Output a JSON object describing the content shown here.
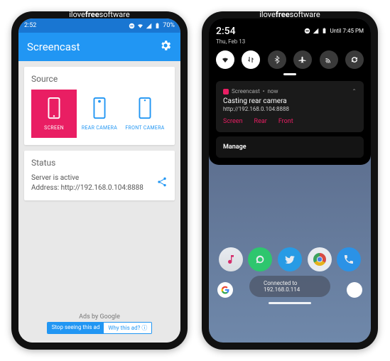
{
  "brand": {
    "part1": "ilove",
    "part2": "free",
    "part3": "software"
  },
  "phoneA": {
    "status": {
      "time": "2:52",
      "battery": "70%"
    },
    "appbar": {
      "title": "Screencast"
    },
    "source": {
      "title": "Source",
      "items": [
        {
          "label": "SCREEN",
          "active": true
        },
        {
          "label": "REAR CAMERA",
          "active": false
        },
        {
          "label": "FRONT CAMERA",
          "active": false
        }
      ]
    },
    "status_card": {
      "title": "Status",
      "line1": "Server is active",
      "line2": "Address: http://192.168.0.104:8888"
    },
    "ads": {
      "label": "Ads by Google",
      "stop": "Stop seeing this ad",
      "why": "Why this ad? ⓘ"
    }
  },
  "phoneB": {
    "status": {
      "time": "2:54",
      "until": "Until 7:45 PM",
      "date": "Thu, Feb 13"
    },
    "notification": {
      "app": "Screencast",
      "when": "now",
      "title": "Casting rear camera",
      "sub": "http://192.168.0.104:8888",
      "actions": [
        "Screen",
        "Rear",
        "Front"
      ]
    },
    "manage": "Manage",
    "pill": "Connected to 192.168.0.114"
  }
}
